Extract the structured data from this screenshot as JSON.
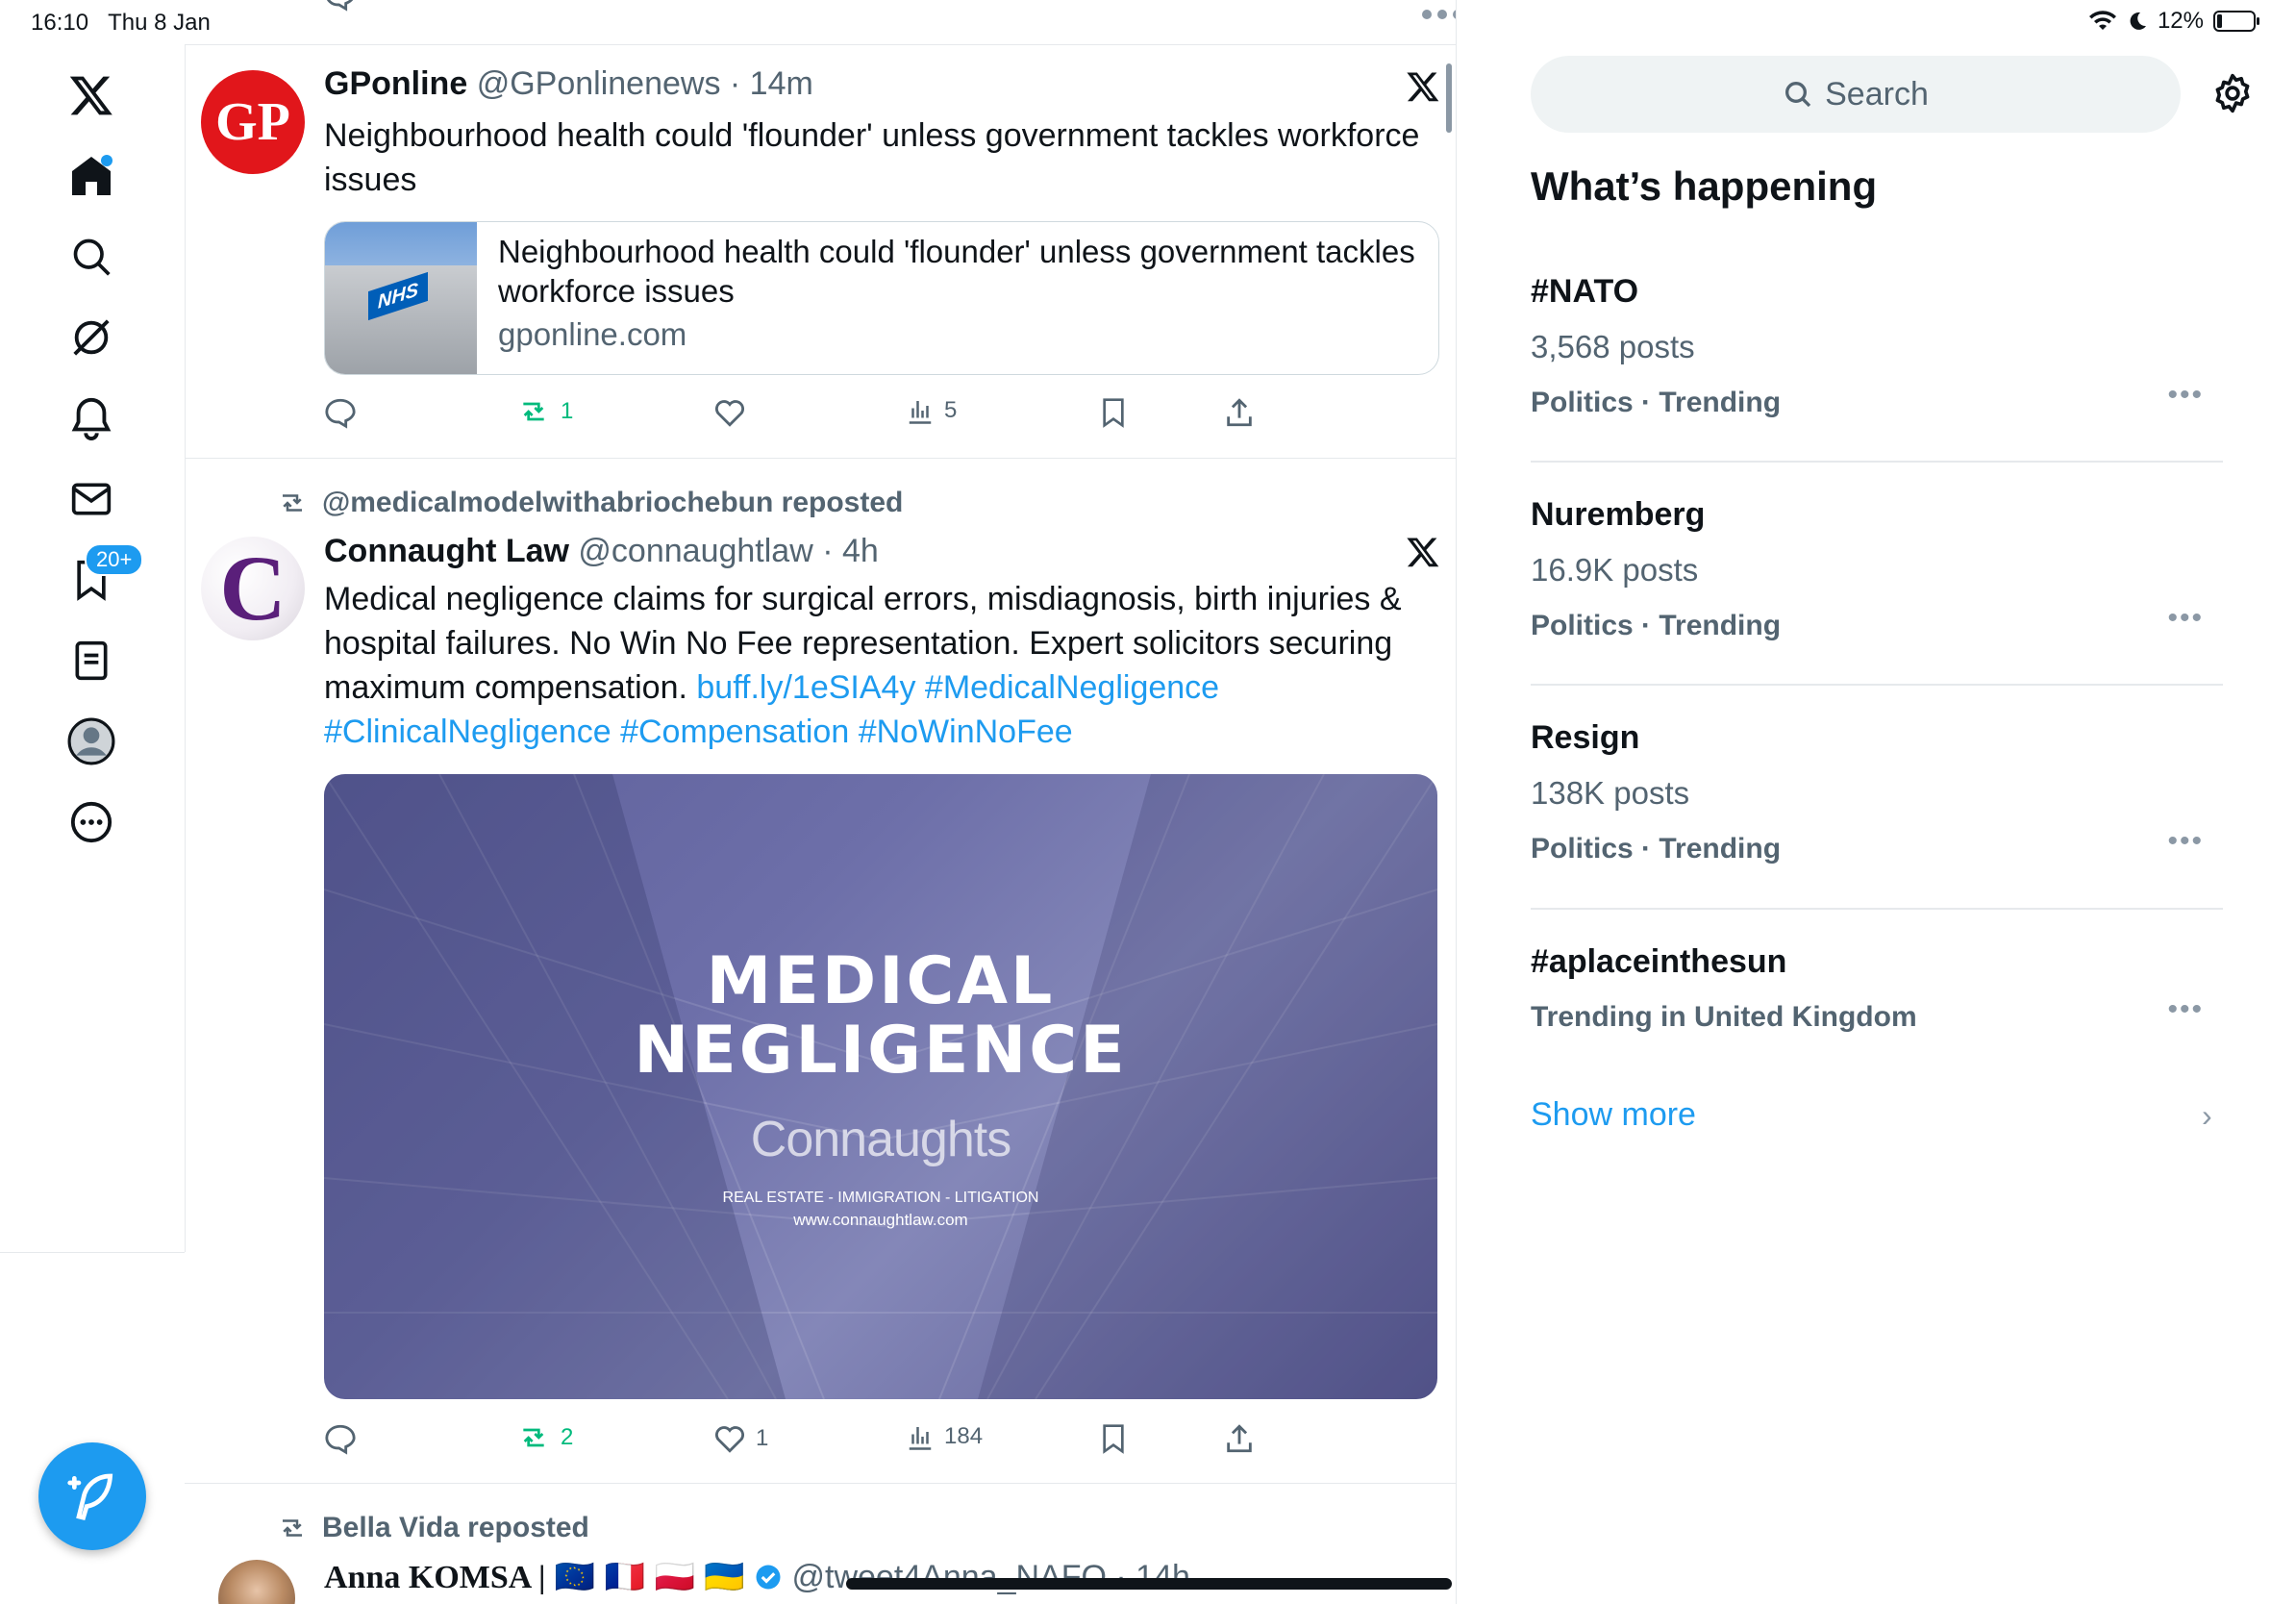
{
  "status": {
    "time": "16:10",
    "date": "Thu 8 Jan",
    "battery": "12%"
  },
  "nav": {
    "items": [
      "x-logo-icon",
      "home-icon",
      "search-icon",
      "grok-icon",
      "notifications-icon",
      "messages-icon",
      "bookmarks-icon",
      "lists-icon",
      "profile-icon",
      "more-icon"
    ],
    "notifications_badge": "20+"
  },
  "colors": {
    "accent": "#1d9bf0",
    "repost_green": "#00ba7c",
    "text": "#0f1419",
    "muted": "#536471"
  },
  "posts": [
    {
      "name": "GPonline",
      "handle": "@GPonlinenews",
      "time": "· 14m",
      "avatar_text": "GP",
      "text": "Neighbourhood health could 'flounder' unless government tackles workforce issues",
      "card": {
        "thumb_label": "NHS",
        "title": "Neighbourhood health could 'flounder' unless government tackles workforce issues",
        "domain": "gponline.com"
      },
      "actions": {
        "replies": "",
        "reposts": "1",
        "likes": "",
        "views": "5"
      }
    },
    {
      "repost_by": "@medicalmodelwithabriochebun reposted",
      "name": "Connaught Law",
      "handle": "@connaughtlaw",
      "time": "· 4h",
      "avatar_text": "C",
      "text": "Medical negligence claims for surgical errors, misdiagnosis, birth injuries & hospital failures. No Win No Fee representation. Expert solicitors securing maximum compensation. ",
      "links": [
        "buff.ly/1eSIA4y",
        "#MedicalNegligence",
        "#ClinicalNegligence",
        "#Compensation",
        "#NoWinNoFee"
      ],
      "media": {
        "title_line1": "MEDICAL",
        "title_line2": "NEGLIGENCE",
        "brand": "Connaughts",
        "tagline": "REAL ESTATE - IMMIGRATION - LITIGATION",
        "url": "www.connaughtlaw.com"
      },
      "actions": {
        "replies": "",
        "reposts": "2",
        "likes": "1",
        "views": "184"
      }
    },
    {
      "repost_by": "Bella Vida reposted",
      "name": "Anna KOMSA |",
      "flags": "🇪🇺 🇫🇷 🇵🇱 🇺🇦",
      "handle": "@tweet4Anna_NAFO",
      "time": "· 14h"
    }
  ],
  "sidebar": {
    "search_placeholder": "Search",
    "title": "What’s happening",
    "trends": [
      {
        "name": "#NATO",
        "count": "3,568 posts",
        "meta": "Politics · Trending"
      },
      {
        "name": "Nuremberg",
        "count": "16.9K posts",
        "meta": "Politics · Trending"
      },
      {
        "name": "Resign",
        "count": "138K posts",
        "meta": "Politics · Trending"
      },
      {
        "name": "#aplaceinthesun",
        "count": "",
        "meta": "Trending in United Kingdom"
      }
    ],
    "show_more": "Show more"
  }
}
